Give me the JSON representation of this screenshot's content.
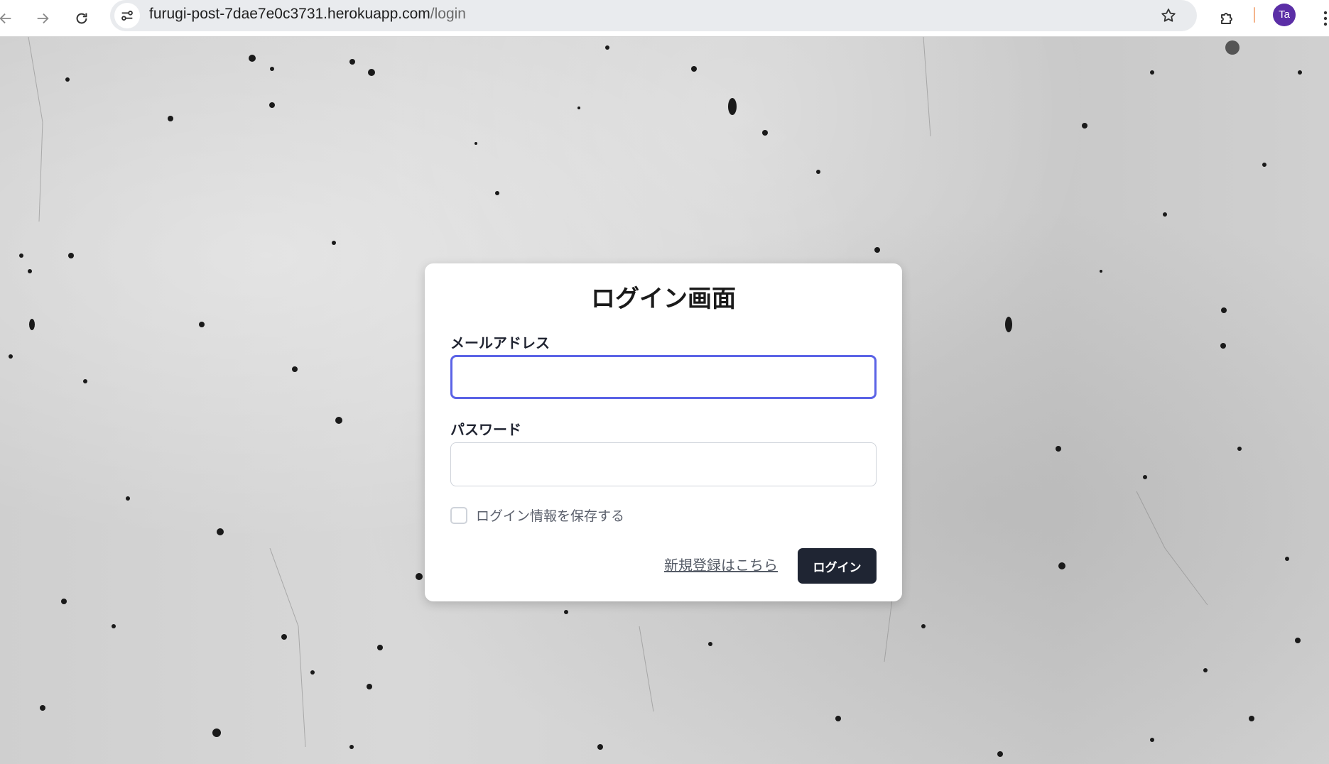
{
  "browser": {
    "url_host": "furugi-post-7dae7e0c3731.herokuapp.com",
    "url_path": "/login",
    "profile_initials": "Ta",
    "icons": [
      "back-arrow-icon",
      "forward-arrow-icon",
      "reload-icon",
      "site-info-icon",
      "bookmark-star-icon",
      "extensions-puzzle-icon",
      "more-vertical-icon"
    ],
    "colors": {
      "avatar": "#5b2ea6",
      "omnibox": "#e9ebee"
    }
  },
  "login": {
    "title": "ログイン画面",
    "email_label": "メールアドレス",
    "email_value": "",
    "password_label": "パスワード",
    "password_value": "",
    "remember_label": "ログイン情報を保存する",
    "remember_checked": false,
    "register_link": "新規登録はこちら",
    "submit_label": "ログイン",
    "colors": {
      "focus_ring": "#5b63e6",
      "button_bg": "#1f2533"
    }
  }
}
